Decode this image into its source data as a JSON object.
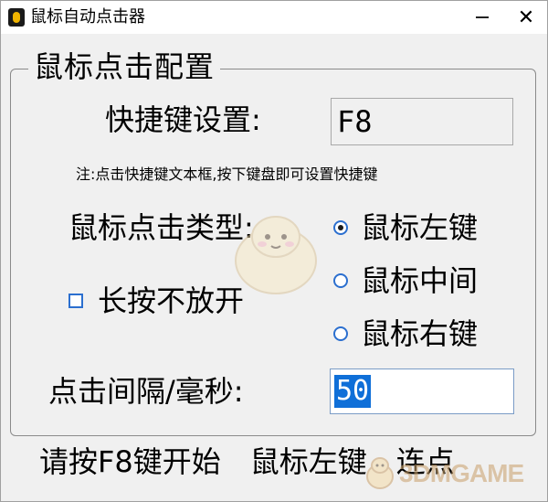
{
  "window": {
    "title": "鼠标自动点击器",
    "minimize_glyph": "—",
    "close_glyph": "✕"
  },
  "group": {
    "title": "鼠标点击配置"
  },
  "hotkey": {
    "label": "快捷键设置:",
    "value": "F8"
  },
  "note": "注:点击快捷键文本框,按下键盘即可设置快捷键",
  "click_type": {
    "label": "鼠标点击类型:",
    "options": [
      {
        "label": "鼠标左键",
        "checked": true
      },
      {
        "label": "鼠标中间",
        "checked": false
      },
      {
        "label": "鼠标右键",
        "checked": false
      }
    ]
  },
  "hold": {
    "label": "长按不放开",
    "checked": false
  },
  "interval": {
    "label": "点击间隔/毫秒:",
    "value": "50"
  },
  "status": {
    "instruction": "请按F8键开始",
    "button_type": "鼠标左键",
    "mode": "连点"
  },
  "watermark": {
    "text": "3DMGAME"
  },
  "icons": {
    "app": "app-icon",
    "mascot": "mascot-watermark-icon",
    "watermark": "3dmgame-logo-icon"
  },
  "colors": {
    "accent": "#0f6fd8",
    "control_border": "#2b6fcf",
    "window_bg": "#f0f0f0"
  }
}
